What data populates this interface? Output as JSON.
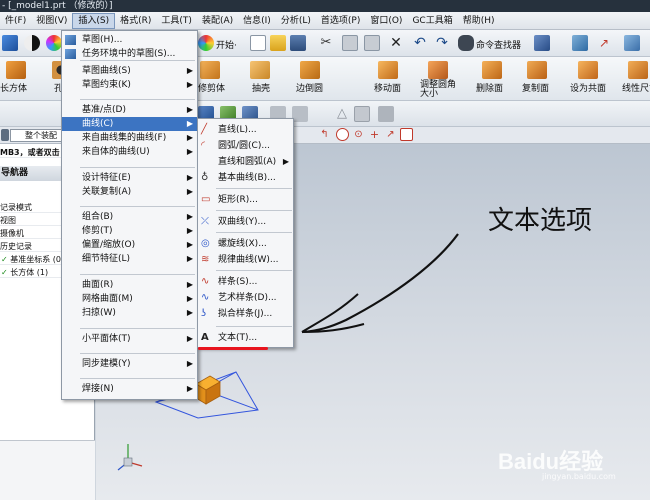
{
  "window": {
    "title": "- [_model1.prt （修改的）]"
  },
  "menubar": {
    "items": [
      "件(F)",
      "视图(V)",
      "插入(S)",
      "格式(R)",
      "工具(T)",
      "装配(A)",
      "信息(I)",
      "分析(L)",
      "首选项(P)",
      "窗口(O)",
      "GC工具箱",
      "帮助(H)"
    ]
  },
  "toolbar1": {
    "start_label": "开始·",
    "command_finder_label": "命令查找器"
  },
  "toolbar2": {
    "labels": [
      "长方体",
      "孔",
      "修剪体",
      "抽壳",
      "边倒圆",
      "移动面",
      "调整圆角大小",
      "删除面",
      "复制面",
      "设为共面",
      "线性尺寸"
    ]
  },
  "toolbar4": {
    "assembly_filter": "整个装配"
  },
  "navigator": {
    "partial_label": "MB3，或者双击",
    "header": "导航器",
    "rows": [
      "记录模式",
      "视图",
      "摄像机",
      "历史记录",
      "基准坐标系 (0)",
      "长方体 (1)"
    ]
  },
  "insert_menu": {
    "items": [
      {
        "label": "草图(H)...",
        "arrow": false
      },
      {
        "label": "任务环境中的草图(S)...",
        "arrow": false
      },
      {
        "label": "草图曲线(S)",
        "arrow": true
      },
      {
        "label": "草图约束(K)",
        "arrow": true
      },
      {
        "label": "基准/点(D)",
        "arrow": true
      },
      {
        "label": "曲线(C)",
        "arrow": true,
        "highlight": true
      },
      {
        "label": "来自曲线集的曲线(F)",
        "arrow": true
      },
      {
        "label": "来自体的曲线(U)",
        "arrow": true
      },
      {
        "label": "设计特征(E)",
        "arrow": true
      },
      {
        "label": "关联复制(A)",
        "arrow": true
      },
      {
        "label": "组合(B)",
        "arrow": true
      },
      {
        "label": "修剪(T)",
        "arrow": true
      },
      {
        "label": "偏置/缩放(O)",
        "arrow": true
      },
      {
        "label": "细节特征(L)",
        "arrow": true
      },
      {
        "label": "曲面(R)",
        "arrow": true
      },
      {
        "label": "网格曲面(M)",
        "arrow": true
      },
      {
        "label": "扫掠(W)",
        "arrow": true
      },
      {
        "label": "小平面体(T)",
        "arrow": true
      },
      {
        "label": "同步建模(Y)",
        "arrow": true
      },
      {
        "label": "焊接(N)",
        "arrow": true
      }
    ]
  },
  "curve_submenu": {
    "items": [
      {
        "label": "直线(L)...",
        "icon": "line-icon",
        "arrow": false
      },
      {
        "label": "圆弧/圆(C)...",
        "icon": "arc-icon",
        "arrow": false
      },
      {
        "label": "直线和圆弧(A)",
        "icon": "",
        "arrow": true
      },
      {
        "label": "基本曲线(B)...",
        "icon": "basic-curve-icon",
        "arrow": false
      },
      {
        "label": "矩形(R)...",
        "icon": "rectangle-icon",
        "arrow": false
      },
      {
        "label": "双曲线(Y)...",
        "icon": "hyperbola-icon",
        "arrow": false
      },
      {
        "label": "螺旋线(X)...",
        "icon": "helix-icon",
        "arrow": false
      },
      {
        "label": "规律曲线(W)...",
        "icon": "law-curve-icon",
        "arrow": false
      },
      {
        "label": "样条(S)...",
        "icon": "spline-icon",
        "arrow": false
      },
      {
        "label": "艺术样条(D)...",
        "icon": "studio-spline-icon",
        "arrow": false
      },
      {
        "label": "拟合样条(J)...",
        "icon": "fit-spline-icon",
        "arrow": false
      },
      {
        "label": "文本(T)...",
        "icon": "text-icon",
        "arrow": false
      }
    ]
  },
  "annotation": {
    "text": "文本选项",
    "underline_color": "#e8141e"
  },
  "watermark": {
    "text": "Baidu经验",
    "sub": "jingyan.baidu.com"
  },
  "colors": {
    "highlight": "#3c74c2",
    "menu_bg": "#f5f6f8",
    "annotation_red": "#e8141e"
  }
}
